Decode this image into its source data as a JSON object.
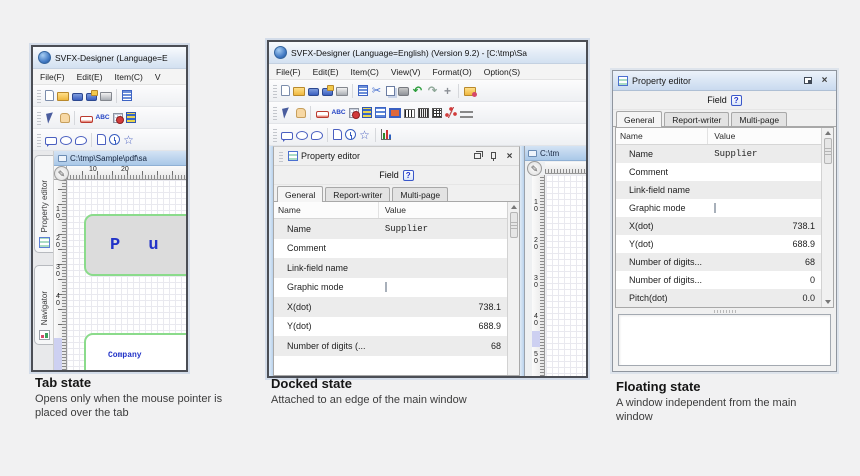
{
  "colors": {
    "titlebar_blue": "#d3e1f1",
    "doc_tab_blue": "#a9c8e8",
    "canvas_text_blue": "#2233c8",
    "shape_border_green": "#8bdb8b",
    "help_border_blue": "#3a57c9",
    "ruler_highlight_purple": "#cdd0f1",
    "window_border": "#4b4e55"
  },
  "icons": {
    "abc": "ABC",
    "help": "?",
    "close": "×"
  },
  "captions": {
    "tab": {
      "title": "Tab state",
      "desc": "Opens only when the mouse pointer is placed over the tab"
    },
    "docked": {
      "title": "Docked state",
      "desc": "Attached to an edge of the main window"
    },
    "floating": {
      "title": "Floating state",
      "desc": "A window independent from the main window"
    }
  },
  "tab_window": {
    "title": "SVFX-Designer (Language=E",
    "menus": [
      "File(F)",
      "Edit(E)",
      "Item(C)",
      "V"
    ],
    "doc_tab": "C:\\tmp\\Sample\\pdf\\sa",
    "h_ruler": [
      "10",
      "20"
    ],
    "v_ruler": [
      "10",
      "20",
      "30",
      "40"
    ],
    "canvas_field_text": "P u",
    "canvas_label_text": "Company",
    "side_tab_property_editor": "Property editor",
    "side_tab_navigator": "Navigator"
  },
  "docked_window": {
    "title": "SVFX-Designer (Language=English) (Version 9.2) - [C:\\tmp\\Sa",
    "menus": [
      "File(F)",
      "Edit(E)",
      "Item(C)",
      "View(V)",
      "Format(O)",
      "Option(S)"
    ],
    "doc_tab": "C:\\tm",
    "v_ruler": [
      "10",
      "20",
      "30",
      "40",
      "50"
    ]
  },
  "property_editor": {
    "title": "Property editor",
    "field_label": "Field",
    "tabs": [
      "General",
      "Report-writer",
      "Multi-page"
    ],
    "columns": {
      "name": "Name",
      "value": "Value"
    },
    "docked_rows": [
      {
        "name": "Name",
        "value": "Supplier"
      },
      {
        "name": "Comment",
        "value": ""
      },
      {
        "name": "Link-field name",
        "value": ""
      },
      {
        "name": "Graphic mode",
        "value": ""
      },
      {
        "name": "X(dot)",
        "value": "738.1"
      },
      {
        "name": "Y(dot)",
        "value": "688.9"
      },
      {
        "name": "Number of digits (...",
        "value": "68"
      }
    ],
    "floating_rows": [
      {
        "name": "Name",
        "value": "Supplier"
      },
      {
        "name": "Comment",
        "value": ""
      },
      {
        "name": "Link-field name",
        "value": ""
      },
      {
        "name": "Graphic mode",
        "value": ""
      },
      {
        "name": "X(dot)",
        "value": "738.1"
      },
      {
        "name": "Y(dot)",
        "value": "688.9"
      },
      {
        "name": "Number of digits...",
        "value": "68"
      },
      {
        "name": "Number of digits...",
        "value": "0"
      },
      {
        "name": "Pitch(dot)",
        "value": "0.0"
      }
    ]
  }
}
